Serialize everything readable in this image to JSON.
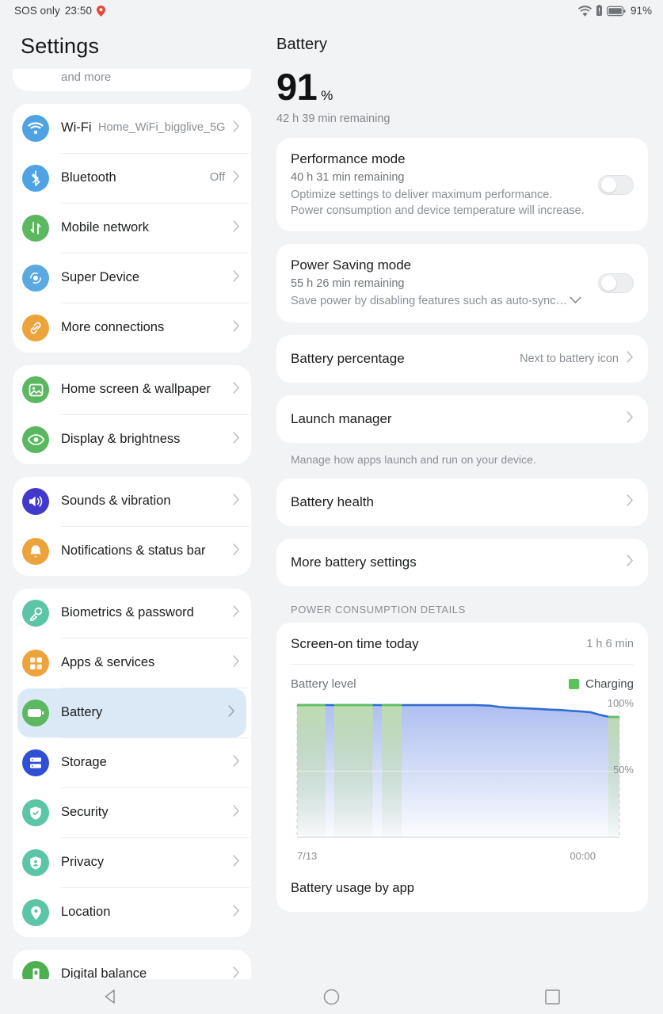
{
  "status_bar": {
    "carrier": "SOS only",
    "time": "23:50",
    "location_icon": "location-pin-icon",
    "wifi_icon": "wifi-alert-icon",
    "battery_alert_icon": "battery-alert-icon",
    "battery_icon": "battery-icon",
    "battery_percent": "91%"
  },
  "sidebar": {
    "title": "Settings",
    "clipped_top_text": "and more",
    "groups": [
      {
        "items": [
          {
            "label": "Wi-Fi",
            "value": "Home_WiFi_bigglive_5G",
            "icon": "wifi-icon",
            "color": "#4fa3e3"
          },
          {
            "label": "Bluetooth",
            "value": "Off",
            "icon": "bluetooth-icon",
            "color": "#4fa3e3"
          },
          {
            "label": "Mobile network",
            "value": "",
            "icon": "mobile-network-icon",
            "color": "#5cb860"
          },
          {
            "label": "Super Device",
            "value": "",
            "icon": "super-device-icon",
            "color": "#5aa9e0"
          },
          {
            "label": "More connections",
            "value": "",
            "icon": "link-icon",
            "color": "#eda33c"
          }
        ]
      },
      {
        "items": [
          {
            "label": "Home screen & wallpaper",
            "value": "",
            "icon": "wallpaper-icon",
            "color": "#5cb860"
          },
          {
            "label": "Display & brightness",
            "value": "",
            "icon": "eye-icon",
            "color": "#5cb860"
          }
        ]
      },
      {
        "items": [
          {
            "label": "Sounds & vibration",
            "value": "",
            "icon": "speaker-icon",
            "color": "#4238cc"
          },
          {
            "label": "Notifications & status bar",
            "value": "",
            "icon": "bell-icon",
            "color": "#eda33c"
          }
        ]
      },
      {
        "items": [
          {
            "label": "Biometrics & password",
            "value": "",
            "icon": "key-icon",
            "color": "#5cc4a7"
          },
          {
            "label": "Apps & services",
            "value": "",
            "icon": "apps-grid-icon",
            "color": "#eda33c"
          },
          {
            "label": "Battery",
            "value": "",
            "icon": "battery-icon",
            "color": "#5cb860",
            "selected": true
          },
          {
            "label": "Storage",
            "value": "",
            "icon": "storage-icon",
            "color": "#2f4fd4"
          },
          {
            "label": "Security",
            "value": "",
            "icon": "shield-check-icon",
            "color": "#5cc4a7"
          },
          {
            "label": "Privacy",
            "value": "",
            "icon": "privacy-shield-icon",
            "color": "#5cc4a7"
          },
          {
            "label": "Location",
            "value": "",
            "icon": "location-icon",
            "color": "#5cc4a7"
          }
        ]
      },
      {
        "items": [
          {
            "label": "Digital balance",
            "value": "",
            "icon": "digital-balance-icon",
            "color": "#4caf50"
          }
        ]
      }
    ]
  },
  "main": {
    "title": "Battery",
    "percent_value": "91",
    "percent_sign": "%",
    "remaining": "42 h 39 min remaining",
    "performance_mode": {
      "title": "Performance mode",
      "remaining": "40 h 31 min remaining",
      "description": "Optimize settings to deliver maximum performance. Power consumption and device temperature will increase.",
      "toggle_on": false
    },
    "power_saving_mode": {
      "title": "Power Saving mode",
      "remaining": "55 h 26 min remaining",
      "description": "Save power by disabling features such as auto-sync…",
      "expand_icon": "chevron-down-icon",
      "toggle_on": false
    },
    "battery_percentage": {
      "title": "Battery percentage",
      "value": "Next to battery icon"
    },
    "launch_manager": {
      "title": "Launch manager",
      "helper": "Manage how apps launch and run on your device."
    },
    "battery_health": {
      "title": "Battery health"
    },
    "more_battery_settings": {
      "title": "More battery settings"
    },
    "section_label": "POWER CONSUMPTION DETAILS",
    "screen_on_time": {
      "title": "Screen-on time today",
      "value": "1 h 6 min"
    },
    "battery_usage_by_app": "Battery usage by app"
  },
  "chart_data": {
    "type": "area",
    "title": "Battery level",
    "legend": [
      {
        "name": "Charging",
        "color": "#5cc35c"
      }
    ],
    "line_color": "#2f6cd4",
    "discharge_fill": "#aebff0",
    "charge_fill": "#bfdcb0",
    "xlabel": "",
    "ylabel": "",
    "ylim": [
      0,
      100
    ],
    "yticks": [
      "100%",
      "50%"
    ],
    "ytick_values": [
      100,
      50
    ],
    "xticks": [
      "7/13",
      "00:00"
    ],
    "x": [
      0,
      5,
      9,
      12,
      18,
      24,
      27,
      31,
      40,
      50,
      55,
      60,
      63,
      66,
      70,
      74,
      78,
      82,
      85,
      88,
      91,
      94,
      97,
      100
    ],
    "values": [
      100,
      100,
      100,
      100,
      100,
      100,
      100,
      100,
      100,
      100,
      100,
      99.5,
      98.5,
      98,
      97.6,
      97.2,
      96.6,
      96.2,
      95.6,
      95.2,
      94.6,
      92.5,
      91,
      91
    ],
    "charging_spans": [
      {
        "start": 0,
        "end": 8.8
      },
      {
        "start": 11.5,
        "end": 23.5
      },
      {
        "start": 26.3,
        "end": 32.5
      },
      {
        "start": 96.5,
        "end": 100
      }
    ],
    "series": [
      {
        "name": "Battery level",
        "values": [
          100,
          100,
          100,
          100,
          100,
          100,
          100,
          100,
          100,
          100,
          100,
          99.5,
          98.5,
          98,
          97.6,
          97.2,
          96.6,
          96.2,
          95.6,
          95.2,
          94.6,
          92.5,
          91,
          91
        ]
      }
    ]
  },
  "navbar": {
    "back": "back-icon",
    "home": "home-icon",
    "recents": "recents-icon"
  }
}
